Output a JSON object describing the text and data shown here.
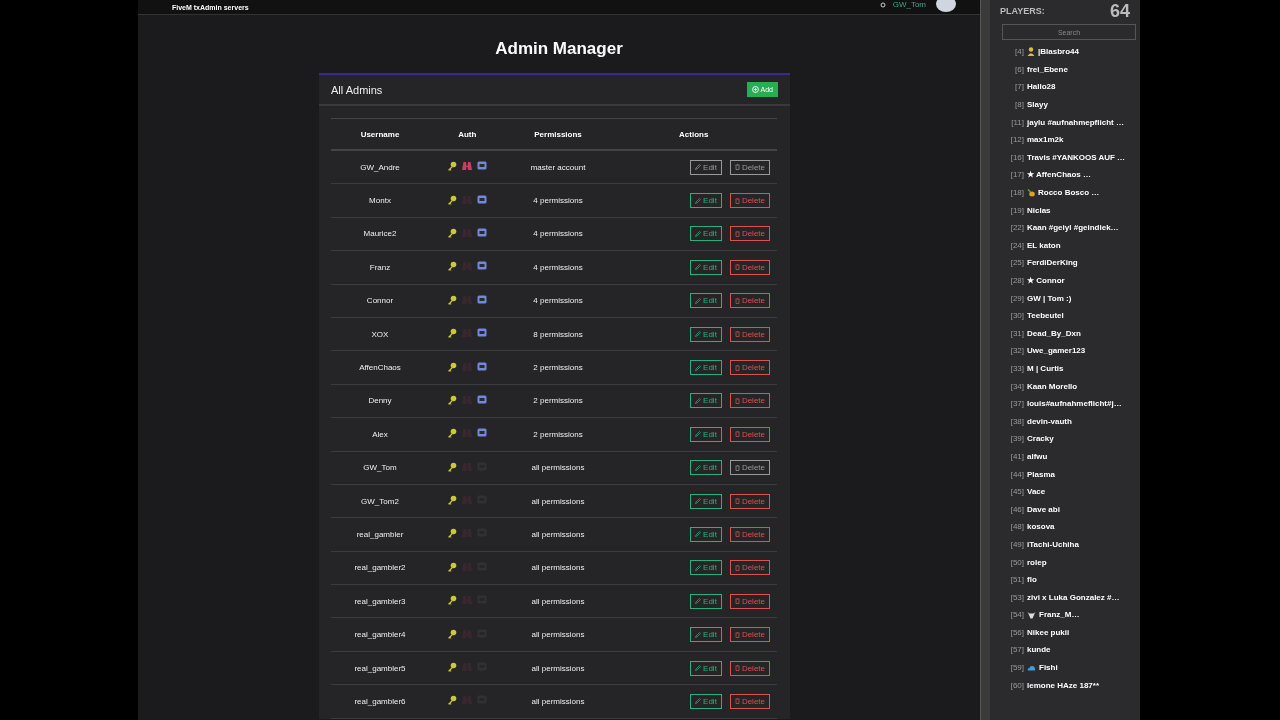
{
  "topbar": {
    "link": "FiveM txAdmin servers",
    "username": "GW_Tom"
  },
  "page_title": "Admin Manager",
  "card": {
    "title": "All Admins",
    "add_button": "Add"
  },
  "table": {
    "columns": [
      "Username",
      "Auth",
      "Permissions",
      "Actions"
    ],
    "rows": [
      {
        "username": "GW_Andre",
        "cfx": true,
        "github": true,
        "discord": true,
        "permissions": "master account",
        "edit": {
          "label": "Edit",
          "disabled": true
        },
        "delete": {
          "label": "Delete",
          "disabled": true
        }
      },
      {
        "username": "Montx",
        "cfx": true,
        "github": false,
        "discord": true,
        "permissions": "4 permissions",
        "edit": {
          "label": "Edit",
          "disabled": false
        },
        "delete": {
          "label": "Delete",
          "disabled": false
        }
      },
      {
        "username": "Maurice2",
        "cfx": true,
        "github": false,
        "discord": true,
        "permissions": "4 permissions",
        "edit": {
          "label": "Edit",
          "disabled": false
        },
        "delete": {
          "label": "Delete",
          "disabled": false
        }
      },
      {
        "username": "Franz",
        "cfx": true,
        "github": false,
        "discord": true,
        "permissions": "4 permissions",
        "edit": {
          "label": "Edit",
          "disabled": false
        },
        "delete": {
          "label": "Delete",
          "disabled": false
        }
      },
      {
        "username": "Connor",
        "cfx": true,
        "github": false,
        "discord": true,
        "permissions": "4 permissions",
        "edit": {
          "label": "Edit",
          "disabled": false
        },
        "delete": {
          "label": "Delete",
          "disabled": false
        }
      },
      {
        "username": "XOX",
        "cfx": true,
        "github": false,
        "discord": true,
        "permissions": "8 permissions",
        "edit": {
          "label": "Edit",
          "disabled": false
        },
        "delete": {
          "label": "Delete",
          "disabled": false
        }
      },
      {
        "username": "AffenChaos",
        "cfx": true,
        "github": false,
        "discord": true,
        "permissions": "2 permissions",
        "edit": {
          "label": "Edit",
          "disabled": false
        },
        "delete": {
          "label": "Delete",
          "disabled": false
        }
      },
      {
        "username": "Denny",
        "cfx": true,
        "github": false,
        "discord": true,
        "permissions": "2 permissions",
        "edit": {
          "label": "Edit",
          "disabled": false
        },
        "delete": {
          "label": "Delete",
          "disabled": false
        }
      },
      {
        "username": "Alex",
        "cfx": true,
        "github": false,
        "discord": true,
        "permissions": "2 permissions",
        "edit": {
          "label": "Edit",
          "disabled": false
        },
        "delete": {
          "label": "Delete",
          "disabled": false
        }
      },
      {
        "username": "GW_Tom",
        "cfx": true,
        "github": false,
        "discord": false,
        "permissions": "all permissions",
        "edit": {
          "label": "Edit",
          "disabled": false
        },
        "delete": {
          "label": "Delete",
          "disabled": true
        }
      },
      {
        "username": "GW_Tom2",
        "cfx": true,
        "github": false,
        "discord": false,
        "permissions": "all permissions",
        "edit": {
          "label": "Edit",
          "disabled": false
        },
        "delete": {
          "label": "Delete",
          "disabled": false
        }
      },
      {
        "username": "real_gambler",
        "cfx": true,
        "github": false,
        "discord": false,
        "permissions": "all permissions",
        "edit": {
          "label": "Edit",
          "disabled": false
        },
        "delete": {
          "label": "Delete",
          "disabled": false
        }
      },
      {
        "username": "real_gambler2",
        "cfx": true,
        "github": false,
        "discord": false,
        "permissions": "all permissions",
        "edit": {
          "label": "Edit",
          "disabled": false
        },
        "delete": {
          "label": "Delete",
          "disabled": false
        }
      },
      {
        "username": "real_gambler3",
        "cfx": true,
        "github": false,
        "discord": false,
        "permissions": "all permissions",
        "edit": {
          "label": "Edit",
          "disabled": false
        },
        "delete": {
          "label": "Delete",
          "disabled": false
        }
      },
      {
        "username": "real_gambler4",
        "cfx": true,
        "github": false,
        "discord": false,
        "permissions": "all permissions",
        "edit": {
          "label": "Edit",
          "disabled": false
        },
        "delete": {
          "label": "Delete",
          "disabled": false
        }
      },
      {
        "username": "real_gambler5",
        "cfx": true,
        "github": false,
        "discord": false,
        "permissions": "all permissions",
        "edit": {
          "label": "Edit",
          "disabled": false
        },
        "delete": {
          "label": "Delete",
          "disabled": false
        }
      },
      {
        "username": "real_gambler6",
        "cfx": true,
        "github": false,
        "discord": false,
        "permissions": "all permissions",
        "edit": {
          "label": "Edit",
          "disabled": false
        },
        "delete": {
          "label": "Delete",
          "disabled": false
        }
      }
    ]
  },
  "players_panel": {
    "title": "PLAYERS:",
    "count": "64",
    "search": {
      "placeholder": "Search"
    },
    "players": [
      {
        "id": "[4]",
        "name": "|Blasbro44",
        "kind": "person"
      },
      {
        "id": "[6]",
        "name": "frei_Ebene"
      },
      {
        "id": "[7]",
        "name": "Hallo28"
      },
      {
        "id": "[8]",
        "name": "Slayy"
      },
      {
        "id": "[11]",
        "name": "jaylu #aufnahmepflicht …"
      },
      {
        "id": "[12]",
        "name": "max1m2k"
      },
      {
        "id": "[16]",
        "name": "Travis #YANKOOS AUF …"
      },
      {
        "id": "[17]",
        "name": "★ AffenChaos …"
      },
      {
        "id": "[18]",
        "name": "Rocco Bosco …",
        "kind": "fruit"
      },
      {
        "id": "[19]",
        "name": "Niclas"
      },
      {
        "id": "[22]",
        "name": "Kaan #geiyl #geindiek…"
      },
      {
        "id": "[24]",
        "name": "EL katon"
      },
      {
        "id": "[25]",
        "name": "FerdiDerKing"
      },
      {
        "id": "[28]",
        "name": "★ Connor"
      },
      {
        "id": "[29]",
        "name": "GW | Tom :)"
      },
      {
        "id": "[30]",
        "name": "Teebeutel"
      },
      {
        "id": "[31]",
        "name": "Dead_By_Dxn"
      },
      {
        "id": "[32]",
        "name": "Uwe_gamer123"
      },
      {
        "id": "[33]",
        "name": "M | Curtis"
      },
      {
        "id": "[34]",
        "name": "Kaan Morello"
      },
      {
        "id": "[37]",
        "name": "louis#aufnahmeflicht#j…"
      },
      {
        "id": "[38]",
        "name": "devin-vauth"
      },
      {
        "id": "[39]",
        "name": "Cracky"
      },
      {
        "id": "[41]",
        "name": "alfwu"
      },
      {
        "id": "[44]",
        "name": "Plasma"
      },
      {
        "id": "[45]",
        "name": "Vace"
      },
      {
        "id": "[46]",
        "name": "Dave abi"
      },
      {
        "id": "[48]",
        "name": "kosova"
      },
      {
        "id": "[49]",
        "name": "iTachi-Uchiha"
      },
      {
        "id": "[50]",
        "name": "rolep"
      },
      {
        "id": "[51]",
        "name": "flo"
      },
      {
        "id": "[53]",
        "name": "zivi x Luka Gonzalez #…"
      },
      {
        "id": "[54]",
        "name": "Franz_M…",
        "kind": "bull"
      },
      {
        "id": "[56]",
        "name": "Nikee pukii"
      },
      {
        "id": "[57]",
        "name": "kunde"
      },
      {
        "id": "[59]",
        "name": "Fishi",
        "kind": "cloud"
      },
      {
        "id": "[60]",
        "name": "lemone HAze 187**"
      }
    ]
  }
}
